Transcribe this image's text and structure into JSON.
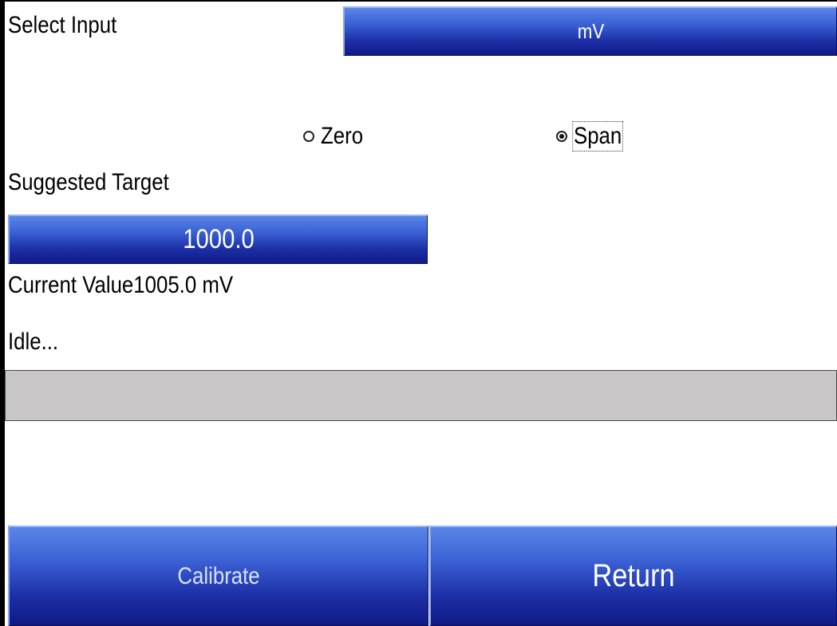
{
  "select_input": {
    "label": "Select Input",
    "value": "mV"
  },
  "mode": {
    "options": [
      {
        "label": "Zero",
        "selected": false
      },
      {
        "label": "Span",
        "selected": true
      }
    ]
  },
  "suggested_target": {
    "label": "Suggested Target",
    "value": "1000.0"
  },
  "current_value": {
    "text": "Current Value1005.0 mV"
  },
  "status": {
    "text": "Idle..."
  },
  "progress": {
    "fraction": 0
  },
  "actions": {
    "calibrate_label": "Calibrate",
    "return_label": "Return"
  },
  "colors": {
    "button_blue": "#1c2fa6",
    "progress_track": "#c8c6c6"
  }
}
